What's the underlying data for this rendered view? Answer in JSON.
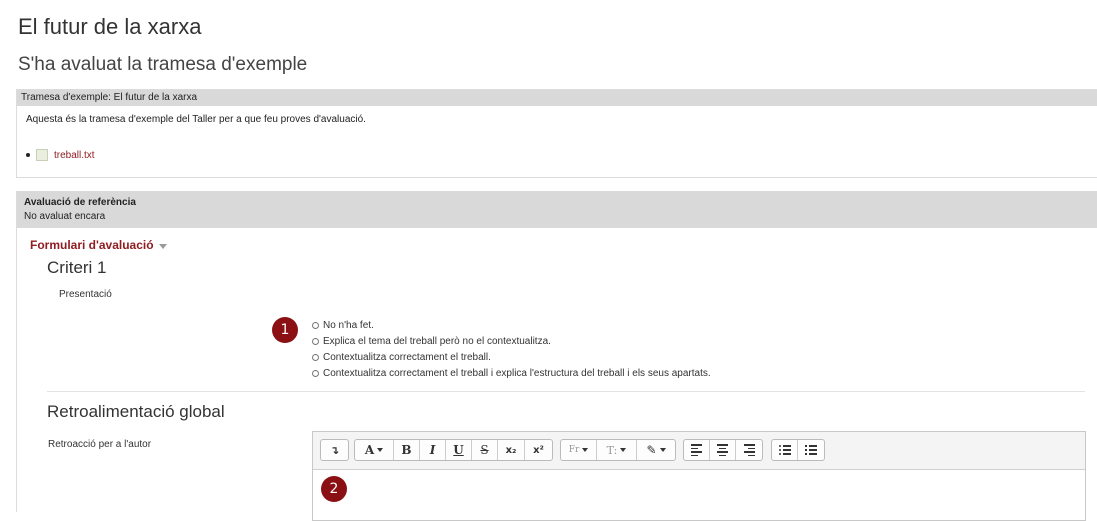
{
  "page": {
    "title": "El futur de la xarxa",
    "subtitle": "S'ha avaluat la tramesa d'exemple"
  },
  "submission": {
    "header": "Tramesa d'exemple: El futur de la xarxa",
    "content": "Aquesta és la tramesa d'exemple del Taller per a que feu proves d'avaluació.",
    "file": "treball.txt"
  },
  "reference": {
    "title": "Avaluació de referència",
    "status": "No avaluat encara"
  },
  "form": {
    "toggle_label": "Formulari d'avaluació",
    "criterion_title": "Criteri 1",
    "criterion_desc": "Presentació",
    "options": [
      "No n'ha fet.",
      "Explica el tema del treball però no el contextualitza.",
      "Contextualitza correctament el treball.",
      "Contextualitza correctament el treball i explica l'estructura del treball i els seus apartats."
    ],
    "feedback_title": "Retroalimentació global",
    "feedback_label": "Retroacció per a l'autor"
  },
  "markers": [
    "1",
    "2"
  ],
  "toolbar": {
    "collapse": "↴",
    "font_color": "A",
    "bold": "B",
    "italic": "I",
    "underline": "U",
    "strike": "S",
    "subscript": "x₂",
    "superscript": "x²",
    "font_family": "Fr",
    "font_size": "T:",
    "brush": "✎"
  },
  "colors": {
    "accent": "#8f1d21",
    "marker": "#8b1014",
    "header_bg": "#d9d9d9"
  }
}
